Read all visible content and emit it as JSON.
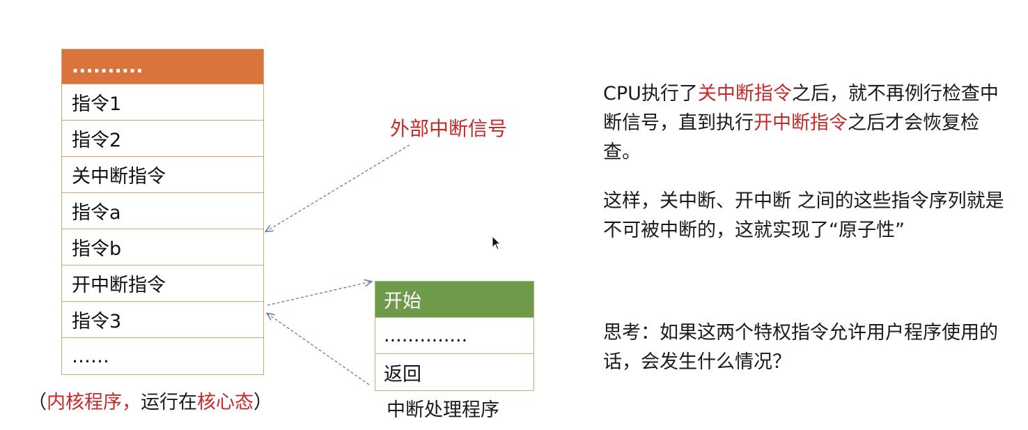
{
  "kernel": {
    "rows": [
      "..........",
      "指令1",
      "指令2",
      "关中断指令",
      "指令a",
      "指令b",
      "开中断指令",
      "指令3",
      "……"
    ],
    "caption_open": "（",
    "caption_kernel_program": "内核程序，",
    "caption_middle": "运行在",
    "caption_kernel_mode": "核心态",
    "caption_close": "）"
  },
  "signal_label": "外部中断信号",
  "handler": {
    "rows": [
      "开始",
      "..............",
      "返回"
    ],
    "caption": "中断处理程序"
  },
  "explanation": {
    "p1_a": "CPU执行了",
    "p1_b": "关中断指令",
    "p1_c": "之后，就不再例行检查中断信号，直到执行",
    "p1_d": "开中断指令",
    "p1_e": "之后才会恢复检查。",
    "p2": "这样，关中断、开中断 之间的这些指令序列就是不可被中断的，这就实现了“原子性”",
    "p3": "思考：如果这两个特权指令允许用户程序使用的话，会发生什么情况？"
  },
  "colors": {
    "kernel_header": "#d9743c",
    "handler_header": "#6f9a4a",
    "highlight_red": "#c42a2a",
    "arrow": "#5a7fa6"
  }
}
